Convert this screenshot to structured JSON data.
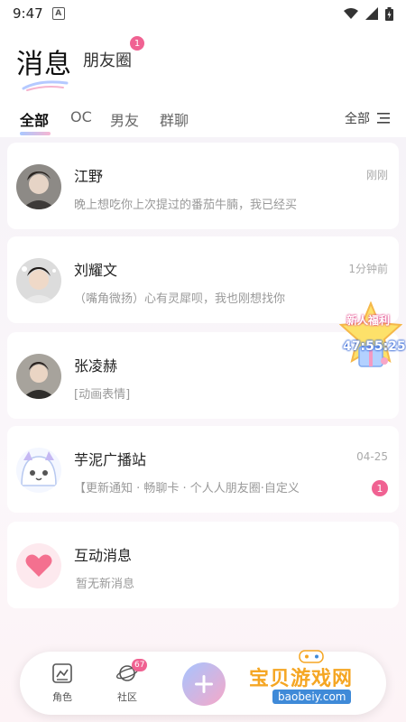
{
  "status_bar": {
    "time": "9:47",
    "a_icon": "A"
  },
  "header": {
    "title": "消息",
    "friends_label": "朋友圈",
    "friends_badge": "1"
  },
  "tabs": [
    {
      "label": "全部",
      "active": true
    },
    {
      "label": "OC",
      "active": false
    },
    {
      "label": "男友",
      "active": false
    },
    {
      "label": "群聊",
      "active": false
    }
  ],
  "filter": {
    "label": "全部",
    "icon": "filter-lines-icon"
  },
  "conversations": [
    {
      "name": "江野",
      "preview": "晚上想吃你上次提过的番茄牛腩，我已经买",
      "time": "刚刚"
    },
    {
      "name": "刘耀文",
      "preview": "（嘴角微扬）心有灵犀呗，我也刚想找你",
      "time": "1分钟前"
    },
    {
      "name": "张凌赫",
      "preview": "[动画表情]",
      "time": ""
    },
    {
      "name": "芋泥广播站",
      "preview": "【更新通知 · 畅聊卡 · 个人人朋友圈·自定义",
      "time": "04-25",
      "unread": "1"
    },
    {
      "name": "互动消息",
      "preview": "暂无新消息",
      "time": ""
    }
  ],
  "promo": {
    "label": "新人福利",
    "timer": "47:55:25"
  },
  "bottom_nav": {
    "items": [
      {
        "label": "角色",
        "icon": "role-card-icon"
      },
      {
        "label": "社区",
        "icon": "planet-icon",
        "badge": "67"
      }
    ],
    "plus_icon": "plus-icon"
  },
  "watermark": {
    "text": "宝贝游戏网",
    "url": "baobeiy.com"
  },
  "colors": {
    "accent_pink": "#f06292",
    "accent_blue": "#a6c4ff",
    "heart": "#f4708f"
  }
}
